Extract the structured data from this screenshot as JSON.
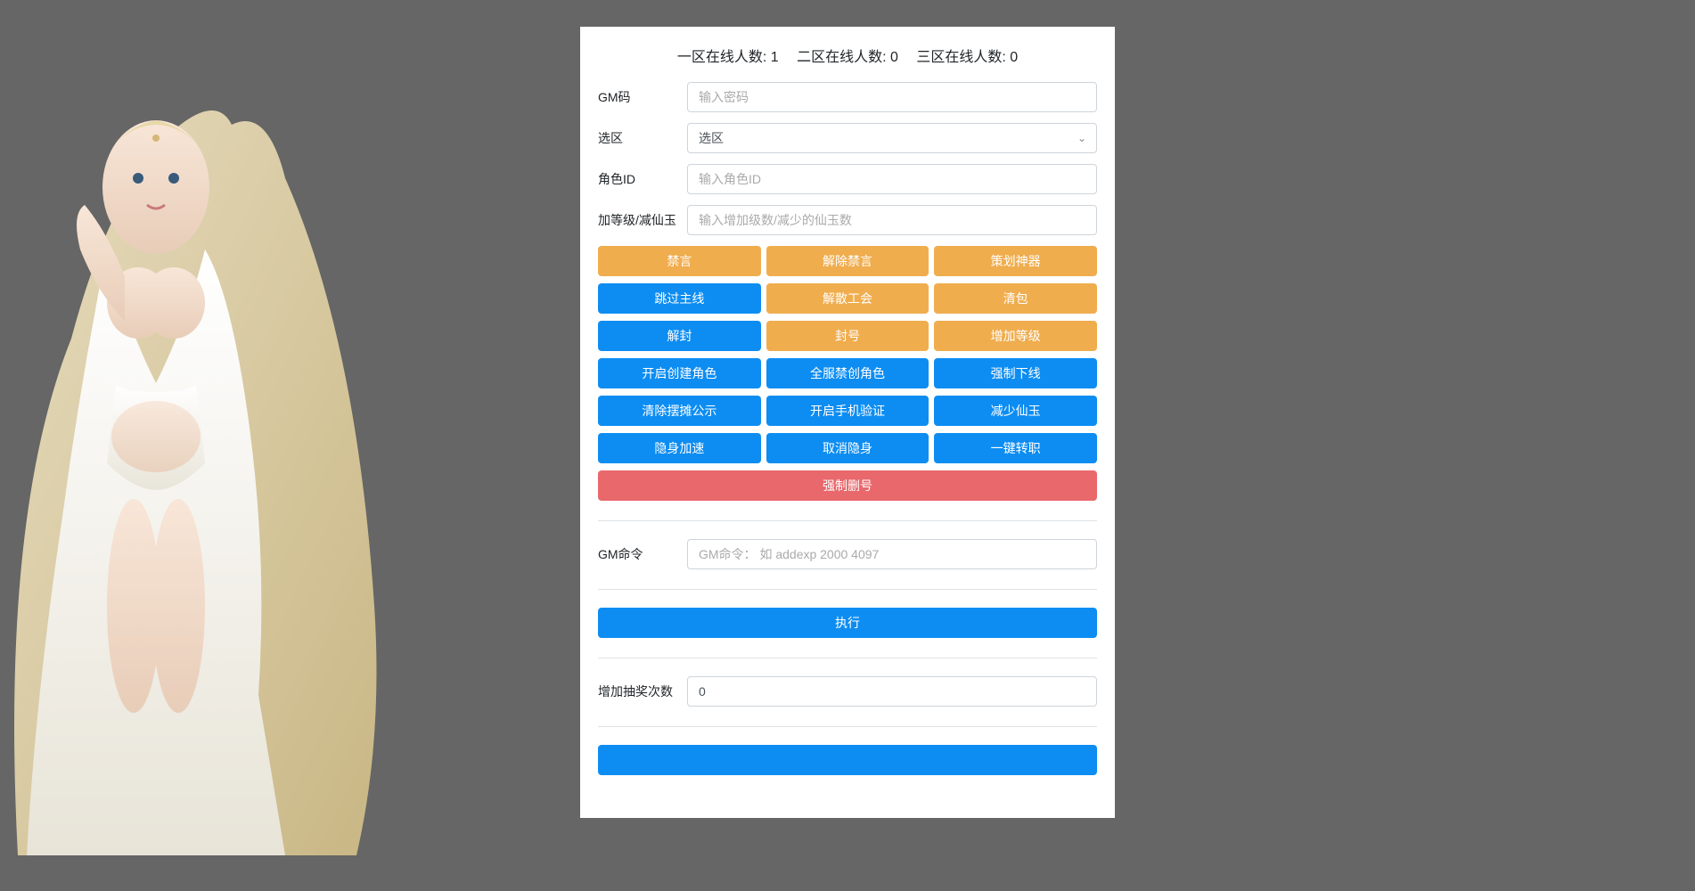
{
  "onlineStats": [
    {
      "label": "一区在线人数:",
      "value": "1"
    },
    {
      "label": "二区在线人数:",
      "value": "0"
    },
    {
      "label": "三区在线人数:",
      "value": "0"
    }
  ],
  "form": {
    "gmCodeLabel": "GM码",
    "gmCodePlaceholder": "输入密码",
    "zoneLabel": "选区",
    "zoneSelectText": "选区",
    "roleIdLabel": "角色ID",
    "roleIdPlaceholder": "输入角色ID",
    "levelJadeLabel": "加等级/减仙玉",
    "levelJadePlaceholder": "输入增加级数/减少的仙玉数"
  },
  "buttons": {
    "row1": [
      "禁言",
      "解除禁言",
      "策划神器"
    ],
    "row2": [
      "跳过主线",
      "解散工会",
      "清包"
    ],
    "row3": [
      "解封",
      "封号",
      "增加等级"
    ],
    "row4": [
      "开启创建角色",
      "全服禁创角色",
      "强制下线"
    ],
    "row5": [
      "清除摆摊公示",
      "开启手机验证",
      "减少仙玉"
    ],
    "row6": [
      "隐身加速",
      "取消隐身",
      "一键转职"
    ],
    "forceDelete": "强制删号"
  },
  "gmCommand": {
    "label": "GM命令",
    "placeholder": "GM命令： 如 addexp 2000 4097",
    "executeLabel": "执行"
  },
  "lottery": {
    "label": "增加抽奖次数",
    "value": "0"
  }
}
